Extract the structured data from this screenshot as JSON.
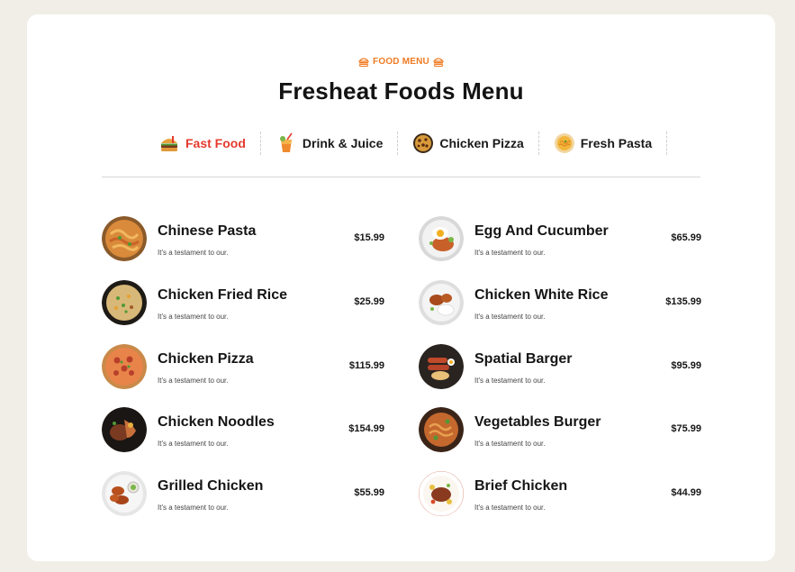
{
  "header": {
    "eyebrow": "FOOD MENU",
    "title": "Fresheat Foods Menu"
  },
  "colors": {
    "accent": "#f07a21",
    "active_tab": "#e63a2e",
    "background": "#f1eee7"
  },
  "tabs": [
    {
      "label": "Fast Food",
      "icon": "burger-icon",
      "active": true
    },
    {
      "label": "Drink & Juice",
      "icon": "juice-icon",
      "active": false
    },
    {
      "label": "Chicken Pizza",
      "icon": "pizza-icon",
      "active": false
    },
    {
      "label": "Fresh Pasta",
      "icon": "pasta-icon",
      "active": false
    }
  ],
  "menu": {
    "left": [
      {
        "name": "Chinese Pasta",
        "desc": "It's a testament to our.",
        "price": "$15.99"
      },
      {
        "name": "Chicken Fried Rice",
        "desc": "It's a testament to our.",
        "price": "$25.99"
      },
      {
        "name": "Chicken Pizza",
        "desc": "It's a testament to our.",
        "price": "$115.99"
      },
      {
        "name": "Chicken Noodles",
        "desc": "It's a testament to our.",
        "price": "$154.99"
      },
      {
        "name": "Grilled Chicken",
        "desc": "It's a testament to our.",
        "price": "$55.99"
      }
    ],
    "right": [
      {
        "name": "Egg And Cucumber",
        "desc": "It's a testament to our.",
        "price": "$65.99"
      },
      {
        "name": "Chicken White Rice",
        "desc": "It's a testament to our.",
        "price": "$135.99"
      },
      {
        "name": "Spatial Barger",
        "desc": "It's a testament to our.",
        "price": "$95.99"
      },
      {
        "name": "Vegetables Burger",
        "desc": "It's a testament to our.",
        "price": "$75.99"
      },
      {
        "name": "Brief Chicken",
        "desc": "It's a testament to our.",
        "price": "$44.99"
      }
    ]
  }
}
